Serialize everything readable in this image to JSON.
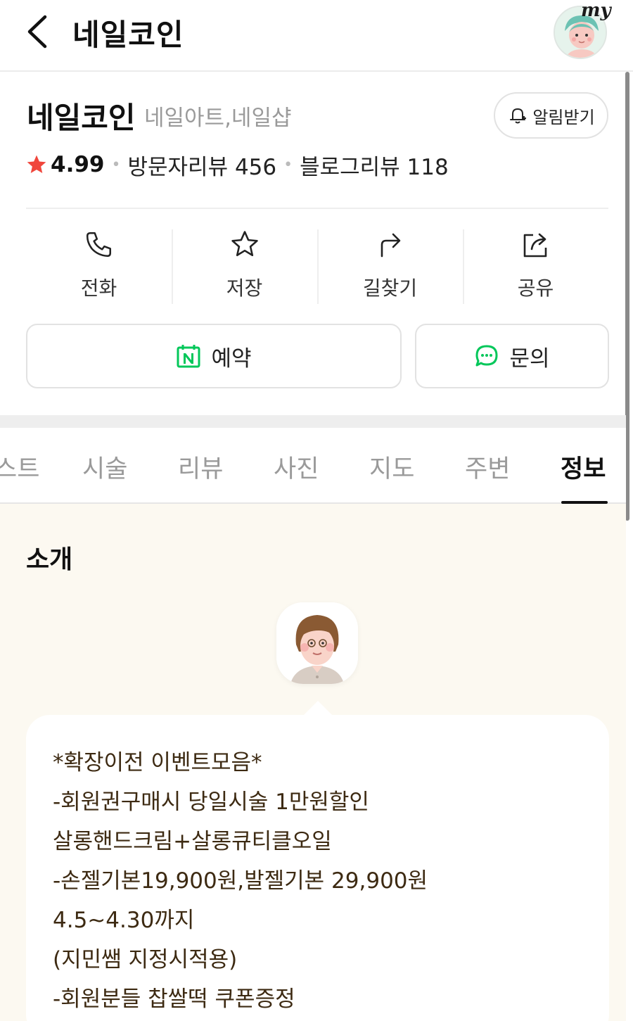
{
  "header": {
    "title": "네일코인",
    "my_label": "my"
  },
  "place": {
    "name": "네일코인",
    "category": "네일아트,네일샵",
    "alarm_label": "알림받기",
    "rating": "4.99",
    "visitor_reviews": "방문자리뷰 456",
    "blog_reviews": "블로그리뷰 118"
  },
  "actions": [
    {
      "label": "전화",
      "icon": "phone-icon"
    },
    {
      "label": "저장",
      "icon": "star-outline-icon"
    },
    {
      "label": "길찾기",
      "icon": "directions-icon"
    },
    {
      "label": "공유",
      "icon": "share-icon"
    }
  ],
  "buttons": {
    "reserve_label": "예약",
    "inquiry_label": "문의"
  },
  "tabs": [
    {
      "label": "스트"
    },
    {
      "label": "시술"
    },
    {
      "label": "리뷰"
    },
    {
      "label": "사진"
    },
    {
      "label": "지도"
    },
    {
      "label": "주변"
    },
    {
      "label": "정보",
      "active": true
    }
  ],
  "info": {
    "title": "소개",
    "description": [
      "*확장이전 이벤트모음*",
      "-회원권구매시 당일시술 1만원할인",
      "살롱핸드크림+살롱큐티클오일",
      "-손젤기본19,900원,발젤기본 29,900원",
      "4.5~4.30까지",
      "(지민쌤 지정시적용)",
      "-회원분들 찹쌀떡 쿠폰증정"
    ]
  },
  "colors": {
    "rating_star": "#f0463c",
    "naver_green": "#03c75a",
    "info_background": "#fcf9f1",
    "description_text": "#3d2a12"
  }
}
